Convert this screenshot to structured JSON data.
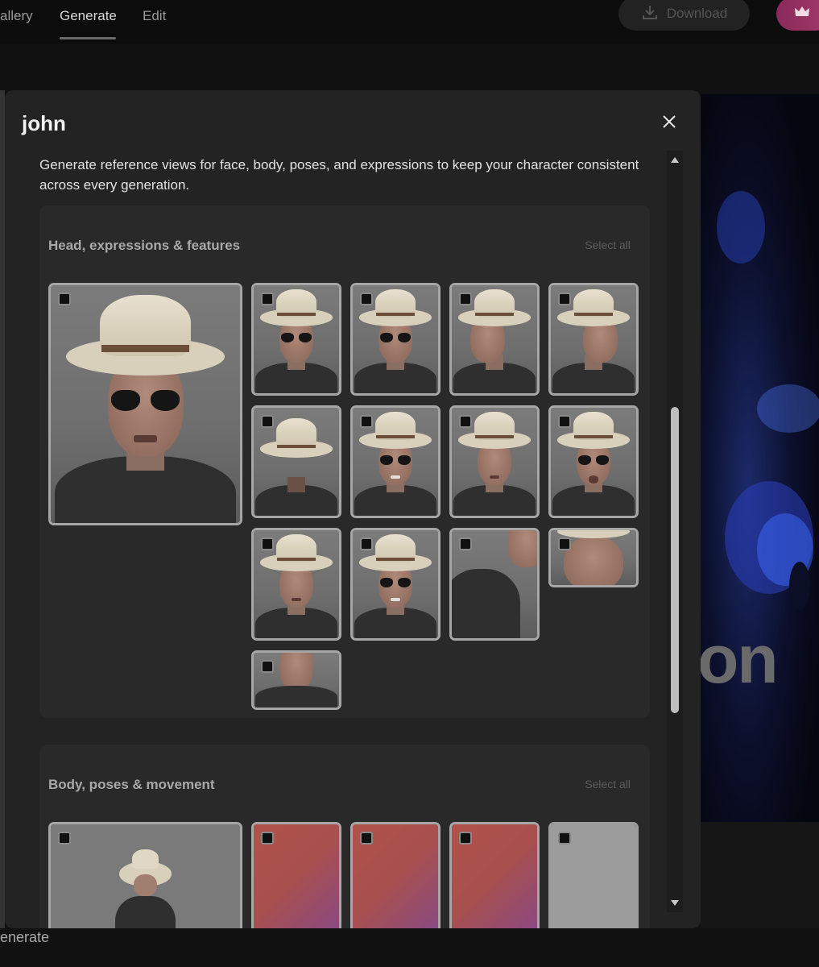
{
  "nav": {
    "tabs": [
      {
        "label": "allery"
      },
      {
        "label": "Generate"
      },
      {
        "label": "Edit"
      }
    ],
    "download_label": "Download"
  },
  "background": {
    "hero_text": "on",
    "footer_text": "enerate"
  },
  "modal": {
    "title": "john",
    "description": "Generate reference views for face, body, poses, and expressions to keep your character consistent across every generation.",
    "sections": [
      {
        "title": "Head, expressions & features",
        "select_all_label": "Select all"
      },
      {
        "title": "Body, poses & movement",
        "select_all_label": "Select all"
      }
    ]
  },
  "colors": {
    "modal_bg": "#232323",
    "section_bg": "#292929",
    "thumb_border": "#a6a6a6",
    "premium_accent": "#a23a6a"
  },
  "icons": {
    "download": "download-icon",
    "premium": "crown-icon",
    "close": "close-icon",
    "checkbox": "checkbox-unchecked"
  }
}
